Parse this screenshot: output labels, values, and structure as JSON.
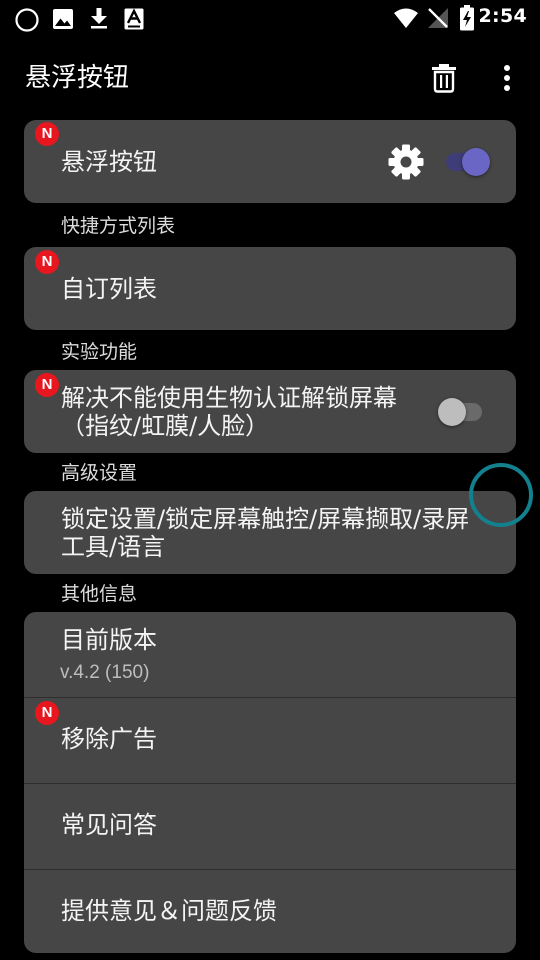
{
  "status_bar": {
    "time": "2:54",
    "left_icons": [
      "circle-icon",
      "image-icon",
      "download-icon",
      "text-a-icon"
    ],
    "right_icons": [
      "wifi-icon",
      "signal-off-icon",
      "battery-charging-icon"
    ]
  },
  "app_bar": {
    "title": "悬浮按钮",
    "actions": [
      "trash-icon",
      "more-vert-icon"
    ]
  },
  "main_card": {
    "label": "悬浮按钮",
    "badge": "N",
    "settings_icon": "gear-icon",
    "toggle_on": true
  },
  "sections": {
    "shortcuts": "快捷方式列表",
    "experimental": "实验功能",
    "advanced": "高级设置",
    "other": "其他信息"
  },
  "shortcuts_card": {
    "label": "自订列表",
    "badge": "N"
  },
  "experimental_card": {
    "label": "解决不能使用生物认证解锁屏幕（指纹/虹膜/人脸）",
    "badge": "N",
    "toggle_on": false
  },
  "advanced_card": {
    "label": "锁定设置/锁定屏幕触控/屏幕撷取/录屏工具/语言"
  },
  "other_card": {
    "version_label": "目前版本",
    "version_value": "v.4.2 (150)",
    "remove_ads": "移除广告",
    "remove_ads_badge": "N",
    "faq": "常见问答",
    "feedback": "提供意见＆问题反馈"
  },
  "colors": {
    "background": "#000000",
    "card": "#464646",
    "badge": "#e8161e",
    "toggle_on_thumb": "#6a66c6",
    "toggle_on_track": "#3f3d77",
    "toggle_off_thumb": "#bdbdbd",
    "toggle_off_track": "#6a6a6a",
    "floating_ring": "#13808e"
  }
}
